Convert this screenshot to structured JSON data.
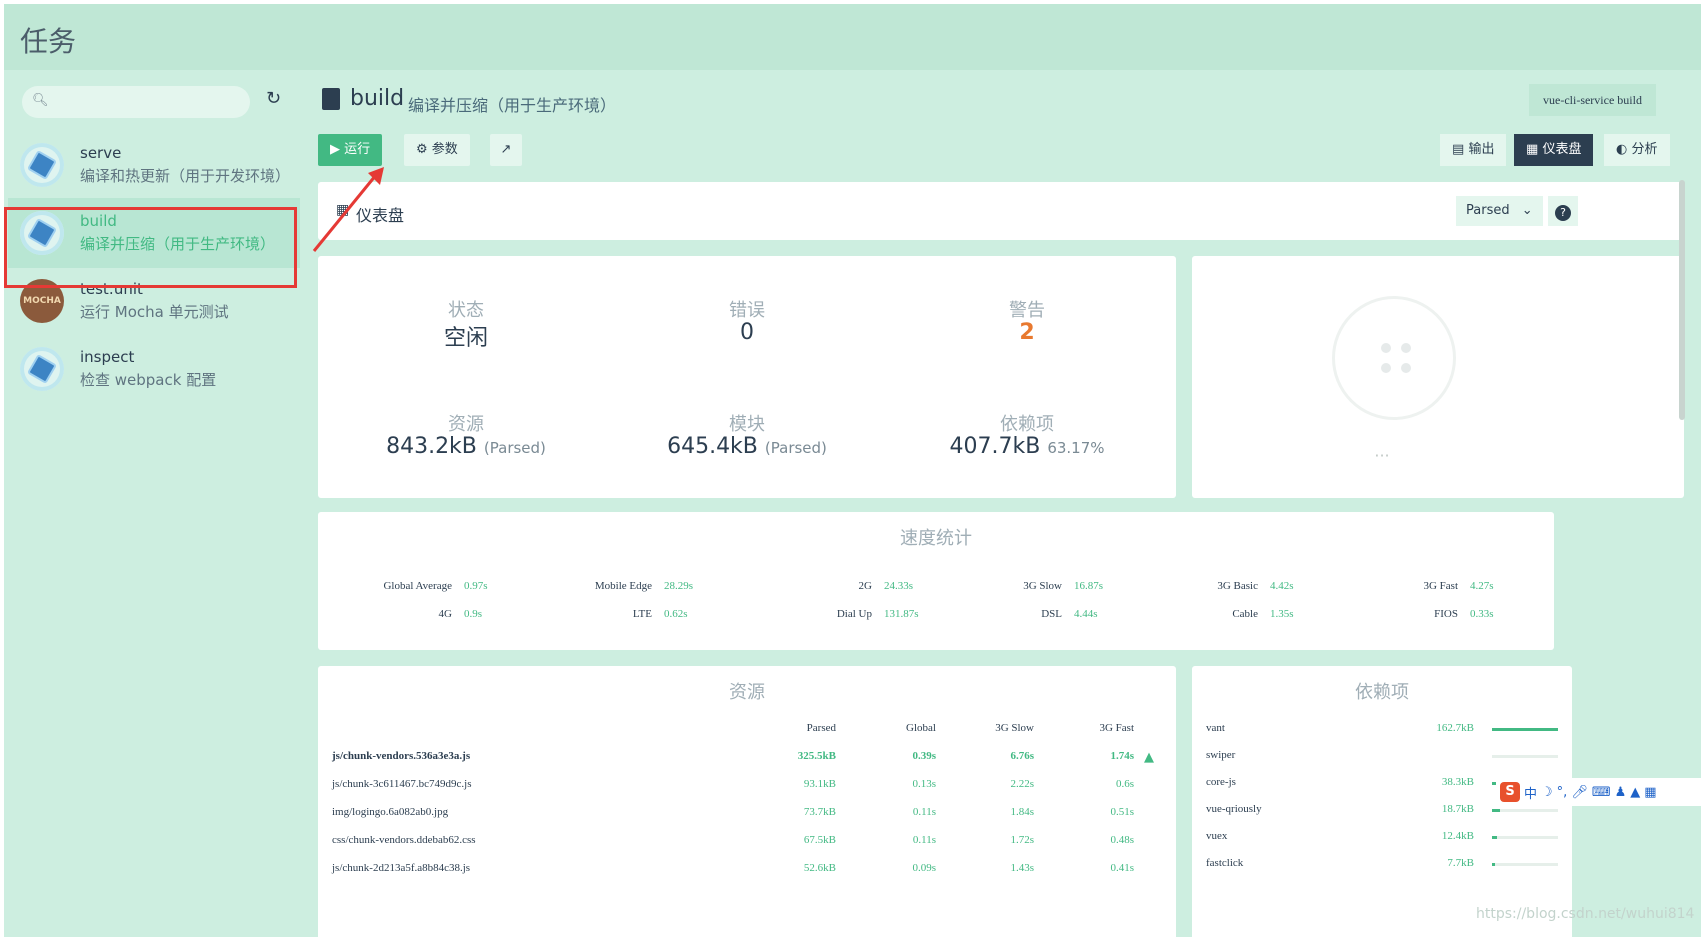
{
  "app": {
    "title": "任务"
  },
  "sidebar": {
    "search_placeholder": "",
    "tasks": [
      {
        "name": "serve",
        "desc": "编译和热更新（用于开发环境）"
      },
      {
        "name": "build",
        "desc": "编译并压缩（用于生产环境）"
      },
      {
        "name": "test:unit",
        "desc": "运行 Mocha 单元测试"
      },
      {
        "name": "inspect",
        "desc": "检查 webpack 配置"
      }
    ],
    "mocha_logo": "MOCHA"
  },
  "header": {
    "title": "build",
    "desc": "编译并压缩（用于生产环境）",
    "command": "vue-cli-service build"
  },
  "toolbar": {
    "run": "运行",
    "params": "参数",
    "output": "输出",
    "dashboard": "仪表盘",
    "analyze": "分析"
  },
  "dashboard": {
    "title": "仪表盘",
    "mode": "Parsed",
    "help": "?"
  },
  "stats": {
    "status_label": "状态",
    "status_value": "空闲",
    "errors_label": "错误",
    "errors_value": "0",
    "warnings_label": "警告",
    "warnings_value": "2",
    "assets_label": "资源",
    "assets_value": "843.2kB",
    "assets_sub": "(Parsed)",
    "modules_label": "模块",
    "modules_value": "645.4kB",
    "modules_sub": "(Parsed)",
    "deps_label": "依赖项",
    "deps_value": "407.7kB",
    "deps_sub": "63.17%"
  },
  "loader": {
    "dots": "···"
  },
  "speed": {
    "title": "速度统计",
    "items": [
      {
        "name": "Global Average",
        "value": "0.97s"
      },
      {
        "name": "Mobile Edge",
        "value": "28.29s"
      },
      {
        "name": "2G",
        "value": "24.33s"
      },
      {
        "name": "3G Slow",
        "value": "16.87s"
      },
      {
        "name": "3G Basic",
        "value": "4.42s"
      },
      {
        "name": "3G Fast",
        "value": "4.27s"
      },
      {
        "name": "4G",
        "value": "0.9s"
      },
      {
        "name": "LTE",
        "value": "0.62s"
      },
      {
        "name": "Dial Up",
        "value": "131.87s"
      },
      {
        "name": "DSL",
        "value": "4.44s"
      },
      {
        "name": "Cable",
        "value": "1.35s"
      },
      {
        "name": "FIOS",
        "value": "0.33s"
      }
    ]
  },
  "assets": {
    "title": "资源",
    "headers": [
      "Parsed",
      "Global",
      "3G Slow",
      "3G Fast"
    ],
    "rows": [
      {
        "name": "js/chunk-vendors.536a3e3a.js",
        "parsed": "325.5kB",
        "global": "0.39s",
        "slow": "6.76s",
        "fast": "1.74s"
      },
      {
        "name": "js/chunk-3c611467.bc749d9c.js",
        "parsed": "93.1kB",
        "global": "0.13s",
        "slow": "2.22s",
        "fast": "0.6s"
      },
      {
        "name": "img/logingo.6a082ab0.jpg",
        "parsed": "73.7kB",
        "global": "0.11s",
        "slow": "1.84s",
        "fast": "0.51s"
      },
      {
        "name": "css/chunk-vendors.ddebab62.css",
        "parsed": "67.5kB",
        "global": "0.11s",
        "slow": "1.72s",
        "fast": "0.48s"
      },
      {
        "name": "js/chunk-2d213a5f.a8b84c38.js",
        "parsed": "52.6kB",
        "global": "0.09s",
        "slow": "1.43s",
        "fast": "0.41s"
      }
    ]
  },
  "deps": {
    "title": "依赖项",
    "rows": [
      {
        "name": "vant",
        "size": "162.7kB",
        "fraction": 1.0
      },
      {
        "name": "swiper",
        "size": "",
        "fraction": 0.0
      },
      {
        "name": "core-js",
        "size": "38.3kB",
        "fraction": 0.24
      },
      {
        "name": "vue-qriously",
        "size": "18.7kB",
        "fraction": 0.12
      },
      {
        "name": "vuex",
        "size": "12.4kB",
        "fraction": 0.08
      },
      {
        "name": "fastclick",
        "size": "7.7kB",
        "fraction": 0.05
      }
    ]
  },
  "ime": {
    "label": "中"
  },
  "watermark": "https://blog.csdn.net/wuhui814",
  "colors": {
    "accent": "#42b983",
    "warning": "#e8792f",
    "highlight": "#e53935",
    "sidebar_bg": "#cdeee0"
  }
}
